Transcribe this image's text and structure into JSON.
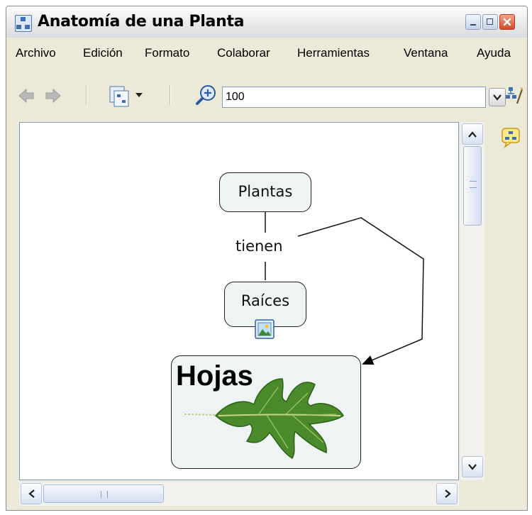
{
  "window": {
    "title": "Anatomía de una Planta"
  },
  "menu": [
    "Archivo",
    "Edición",
    "Formato",
    "Colaborar",
    "Herramientas",
    "Ventana",
    "Ayuda"
  ],
  "toolbar": {
    "zoom_value": "100"
  },
  "concept_map": {
    "nodes": {
      "plantas": "Plantas",
      "raices": "Raíces",
      "hojas": "Hojas"
    },
    "link_label": "tienen"
  },
  "colors": {
    "node_fill": "#eef3f4",
    "node_border": "#1f1f1f",
    "accent": "#3d6fb6",
    "close_red": "#d6492a"
  },
  "icons": [
    "app-concept-map-icon",
    "back-arrow-icon",
    "forward-arrow-icon",
    "view-map-icon",
    "zoom-in-icon",
    "chevron-down-icon",
    "map-settings-icon",
    "chat-icon",
    "image-attachment-icon",
    "leaf-image"
  ]
}
